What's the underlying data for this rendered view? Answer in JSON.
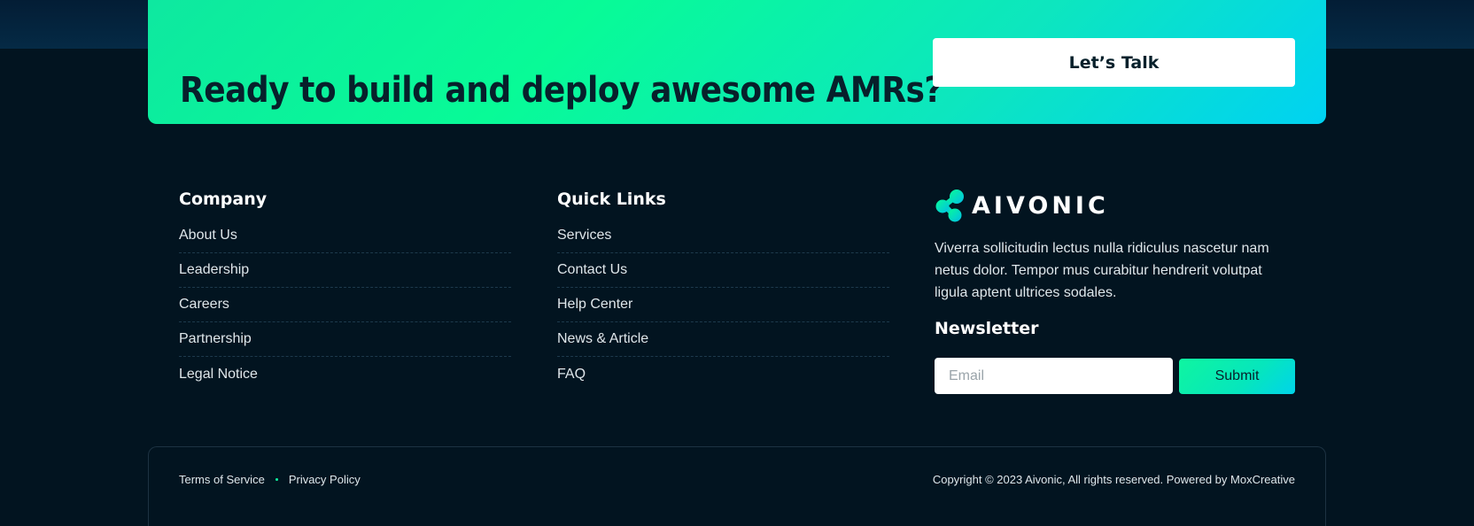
{
  "cta": {
    "heading": "Ready to build and deploy awesome AMRs?",
    "button_label": "Let’s Talk"
  },
  "company": {
    "title": "Company",
    "links": [
      "About Us",
      "Leadership",
      "Careers",
      "Partnership",
      "Legal Notice"
    ]
  },
  "quick_links": {
    "title": "Quick Links",
    "links": [
      "Services",
      "Contact Us",
      "Help Center",
      "News & Article",
      "FAQ"
    ]
  },
  "brand": {
    "logo_text": "AIVONIC",
    "icon": "molecule-logo-icon",
    "description": "Viverra sollicitudin lectus nulla ridiculus nascetur nam netus dolor. Tempor mus curabitur hendrerit volutpat ligula aptent ultrices sodales."
  },
  "newsletter": {
    "title": "Newsletter",
    "email_placeholder": "Email",
    "submit_label": "Submit"
  },
  "footer_bottom": {
    "terms_label": "Terms of Service",
    "privacy_label": "Privacy Policy",
    "copyright": "Copyright © 2023 Aivonic, All rights reserved. Powered by MoxCreative"
  },
  "colors": {
    "background": "#021420",
    "accent_green": "#08fb97",
    "accent_cyan": "#00d2f2",
    "text_dark": "#07202b"
  }
}
